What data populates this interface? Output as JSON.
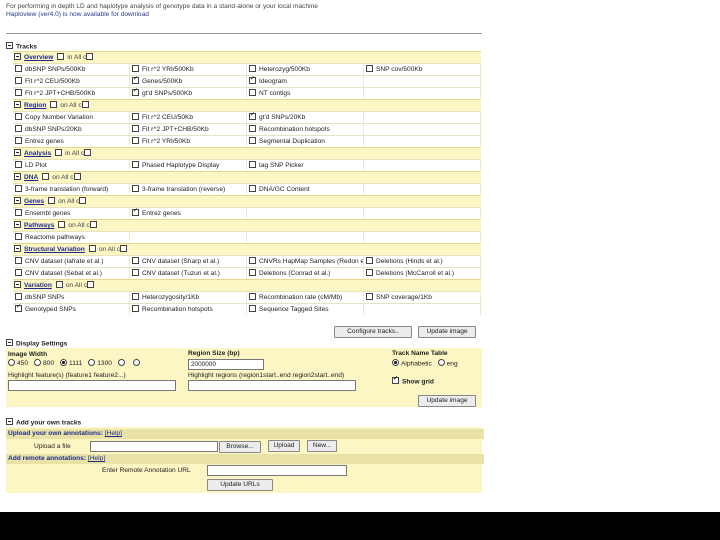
{
  "intro": {
    "line1": "For performing in depth LD and haplotype analysis of genotype data in a stand-alone or your local machine",
    "line2": "Haploview (ver4.0) is now available for download"
  },
  "tracks": {
    "title": "Tracks",
    "groups": [
      {
        "name": "Overview",
        "all": "in All c",
        "rows": [
          [
            {
              "label": "dbSNP SNPs/500Kb",
              "checked": false
            },
            {
              "label": "Fit r^2 YRI/500Kb",
              "checked": false
            },
            {
              "label": "Heterozyg/500Kb",
              "checked": false
            },
            {
              "label": "SNP cov/500Kb",
              "checked": false
            }
          ],
          [
            {
              "label": "Fit r^2 CEU/500Kb",
              "checked": false
            },
            {
              "label": "Genes/500Kb",
              "checked": true
            },
            {
              "label": "Ideogram",
              "checked": true
            },
            {
              "label": "",
              "checked": null
            }
          ],
          [
            {
              "label": "Fit r^2 JPT+CHB/500Kb",
              "checked": false
            },
            {
              "label": "gt'd SNPs/500Kb",
              "checked": true
            },
            {
              "label": "NT contigs",
              "checked": false
            },
            {
              "label": "",
              "checked": null
            }
          ]
        ]
      },
      {
        "name": "Region",
        "all": "on All c",
        "rows": [
          [
            {
              "label": "Copy Number Variation",
              "checked": false
            },
            {
              "label": "Fit r^2 CEU/50Kb",
              "checked": false
            },
            {
              "label": "gt'd SNPs/20Kb",
              "checked": true
            },
            {
              "label": "",
              "checked": null
            }
          ],
          [
            {
              "label": "dbSNP SNPs/20Kb",
              "checked": false
            },
            {
              "label": "Fit r^2 JPT+CHB/50Kb",
              "checked": false
            },
            {
              "label": "Recombination hotspots",
              "checked": false
            },
            {
              "label": "",
              "checked": null
            }
          ],
          [
            {
              "label": "Entrez genes",
              "checked": false
            },
            {
              "label": "Fit r^2 YRI/50Kb",
              "checked": false
            },
            {
              "label": "Segmental Duplication",
              "checked": false
            },
            {
              "label": "",
              "checked": null
            }
          ]
        ]
      },
      {
        "name": "Analysis",
        "all": "in All c",
        "rows": [
          [
            {
              "label": "LD Plot",
              "checked": false
            },
            {
              "label": "Phased Haplotype Display",
              "checked": false
            },
            {
              "label": "tag SNP Picker",
              "checked": false
            },
            {
              "label": "",
              "checked": null
            }
          ]
        ]
      },
      {
        "name": "DNA",
        "all": "on All c",
        "rows": [
          [
            {
              "label": "3-frame translation (forward)",
              "checked": false
            },
            {
              "label": "3-frame translation (reverse)",
              "checked": false
            },
            {
              "label": "DNA/GC Content",
              "checked": false
            },
            {
              "label": "",
              "checked": null
            }
          ]
        ]
      },
      {
        "name": "Genes",
        "all": "on All c",
        "rows": [
          [
            {
              "label": "Ensembl genes",
              "checked": false
            },
            {
              "label": "Entrez genes",
              "checked": true
            },
            {
              "label": "",
              "checked": null
            },
            {
              "label": "",
              "checked": null
            }
          ]
        ]
      },
      {
        "name": "Pathways",
        "all": "on All c",
        "rows": [
          [
            {
              "label": "Reactome pathways",
              "checked": false
            },
            {
              "label": "",
              "checked": null
            },
            {
              "label": "",
              "checked": null
            },
            {
              "label": "",
              "checked": null
            }
          ]
        ]
      },
      {
        "name": "Structural Variation",
        "all": "on All c",
        "rows": [
          [
            {
              "label": "CNV dataset (Iafrate et al.)",
              "checked": false
            },
            {
              "label": "CNV dataset (Sharp et al.)",
              "checked": false
            },
            {
              "label": "CNVRs HapMap Samples (Redon et al.)",
              "checked": false
            },
            {
              "label": "Deletions (Hinds et al.)",
              "checked": false
            }
          ],
          [
            {
              "label": "CNV dataset (Sebat et al.)",
              "checked": false
            },
            {
              "label": "CNV dataset (Tuzun et al.)",
              "checked": false
            },
            {
              "label": "Deletions (Conrad et al.)",
              "checked": false
            },
            {
              "label": "Deletions (McCarroll et al.)",
              "checked": false
            }
          ]
        ]
      },
      {
        "name": "Variation",
        "all": "on All c",
        "rows": [
          [
            {
              "label": "dbSNP SNPs",
              "checked": false
            },
            {
              "label": "Heterozygosity/1Kb",
              "checked": false
            },
            {
              "label": "Recombination rate (cM/Mb)",
              "checked": false
            },
            {
              "label": "SNP coverage/1Kb",
              "checked": false
            }
          ],
          [
            {
              "label": "Genotyped SNPs",
              "checked": true
            },
            {
              "label": "Recombination hotspots",
              "checked": false
            },
            {
              "label": "Sequence Tagged Sites",
              "checked": false
            },
            {
              "label": "",
              "checked": null
            }
          ]
        ]
      }
    ],
    "configure_label": "Configure tracks..",
    "update_label": "Update image"
  },
  "display": {
    "title": "Display Settings",
    "image_width_label": "Image Width",
    "widths": [
      {
        "label": "450",
        "selected": false
      },
      {
        "label": "800",
        "selected": false
      },
      {
        "label": "1111",
        "selected": true
      },
      {
        "label": "1300",
        "selected": false
      },
      {
        "label": "",
        "selected": false
      },
      {
        "label": "",
        "selected": false
      }
    ],
    "region_size_label": "Region Size (bp)",
    "region_size_value": "2000000",
    "track_name_label": "Track Name Table",
    "alpha_label": "Alphabetic",
    "eng_label": "eng",
    "highlight_feature_label": "Highlight feature(s) (feature1 feature2...)",
    "highlight_regions_label": "Highlight regions (region1start..end region2start..end)",
    "show_grid_label": "Show grid",
    "show_grid_checked": true,
    "update_label": "Update image"
  },
  "own": {
    "title": "Add your own tracks",
    "upload_hdr": "Upload your own annotations:",
    "help": "[Help]",
    "upload_file_label": "Upload a file",
    "browse_label": "Browse...",
    "upload_btn": "Upload",
    "new_btn": "New...",
    "remote_hdr": "Add remote annotations:",
    "remote_url_label": "Enter Remote Annotation URL",
    "update_urls_label": "Update URLs"
  }
}
